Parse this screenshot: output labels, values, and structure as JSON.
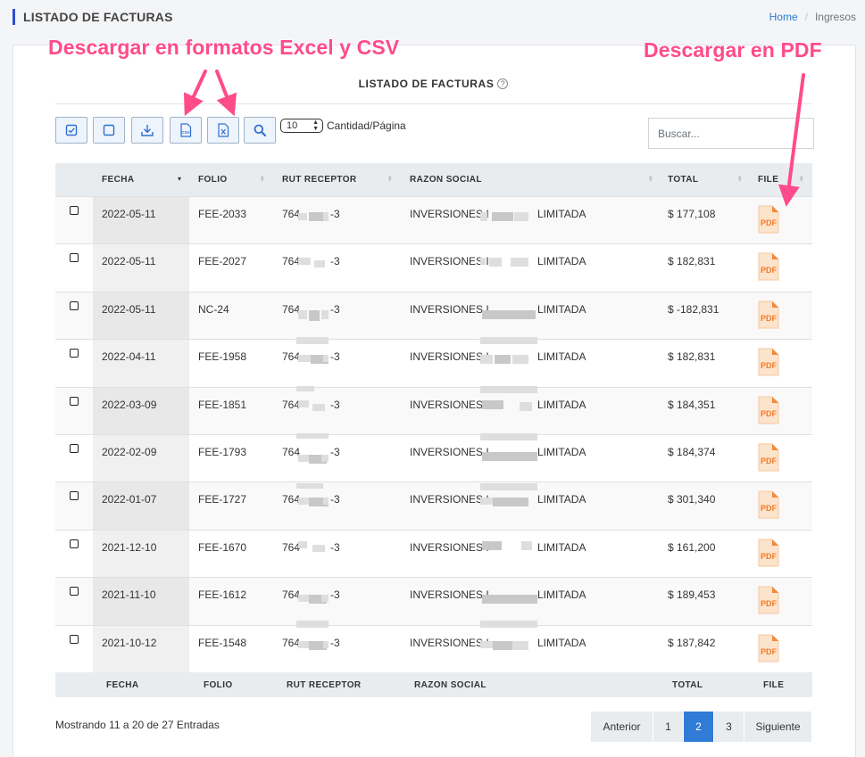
{
  "header": {
    "title": "LISTADO DE FACTURAS",
    "breadcrumb_home": "Home",
    "breadcrumb_separator": "/",
    "breadcrumb_current": "Ingresos"
  },
  "annotations": {
    "excel_csv": "Descargar en formatos Excel y CSV",
    "pdf": "Descargar en PDF",
    "color": "#ff4b8a"
  },
  "card": {
    "title": "LISTADO DE FACTURAS",
    "help_icon": "?"
  },
  "toolbar": {
    "buttons": [
      {
        "name": "select-all-button",
        "icon": "checked-box-icon"
      },
      {
        "name": "deselect-all-button",
        "icon": "empty-box-icon"
      },
      {
        "name": "download-button",
        "icon": "download-icon"
      },
      {
        "name": "csv-button",
        "icon": "csv-file-icon"
      },
      {
        "name": "excel-button",
        "icon": "excel-file-icon"
      },
      {
        "name": "search-button",
        "icon": "magnifier-icon"
      }
    ],
    "page_size": "10",
    "page_size_label": "Cantidad/Página",
    "search_placeholder": "Buscar..."
  },
  "table": {
    "columns": [
      "FECHA",
      "FOLIO",
      "RUT RECEPTOR",
      "RAZON SOCIAL",
      "TOTAL",
      "FILE"
    ],
    "rows": [
      {
        "fecha": "2022-05-11",
        "folio": "FEE-2033",
        "rut_prefix": "764",
        "rut_suffix": "-3",
        "razon_prefix": "INVERSIONES I",
        "razon_suffix": "LIMITADA",
        "total": "$ 177,108",
        "file": "PDF"
      },
      {
        "fecha": "2022-05-11",
        "folio": "FEE-2027",
        "rut_prefix": "764",
        "rut_suffix": "-3",
        "razon_prefix": "INVERSIONES I",
        "razon_suffix": "LIMITADA",
        "total": "$ 182,831",
        "file": "PDF"
      },
      {
        "fecha": "2022-05-11",
        "folio": "NC-24",
        "rut_prefix": "764",
        "rut_suffix": "-3",
        "razon_prefix": "INVERSIONES I",
        "razon_suffix": "LIMITADA",
        "total": "$ -182,831",
        "file": "PDF"
      },
      {
        "fecha": "2022-04-11",
        "folio": "FEE-1958",
        "rut_prefix": "764",
        "rut_suffix": "-3",
        "razon_prefix": "INVERSIONES I",
        "razon_suffix": "LIMITADA",
        "total": "$ 182,831",
        "file": "PDF"
      },
      {
        "fecha": "2022-03-09",
        "folio": "FEE-1851",
        "rut_prefix": "764",
        "rut_suffix": "-3",
        "razon_prefix": "INVERSIONES I",
        "razon_suffix": "LIMITADA",
        "total": "$ 184,351",
        "file": "PDF"
      },
      {
        "fecha": "2022-02-09",
        "folio": "FEE-1793",
        "rut_prefix": "764",
        "rut_suffix": "-3",
        "razon_prefix": "INVERSIONES I",
        "razon_suffix": "LIMITADA",
        "total": "$ 184,374",
        "file": "PDF"
      },
      {
        "fecha": "2022-01-07",
        "folio": "FEE-1727",
        "rut_prefix": "764",
        "rut_suffix": "-3",
        "razon_prefix": "INVERSIONES I",
        "razon_suffix": "LIMITADA",
        "total": "$ 301,340",
        "file": "PDF"
      },
      {
        "fecha": "2021-12-10",
        "folio": "FEE-1670",
        "rut_prefix": "764",
        "rut_suffix": "-3",
        "razon_prefix": "INVERSIONES I",
        "razon_suffix": "LIMITADA",
        "total": "$ 161,200",
        "file": "PDF"
      },
      {
        "fecha": "2021-11-10",
        "folio": "FEE-1612",
        "rut_prefix": "764",
        "rut_suffix": "-3",
        "razon_prefix": "INVERSIONES I",
        "razon_suffix": "LIMITADA",
        "total": "$ 189,453",
        "file": "PDF"
      },
      {
        "fecha": "2021-10-12",
        "folio": "FEE-1548",
        "rut_prefix": "764",
        "rut_suffix": "-3",
        "razon_prefix": "INVERSIONES I",
        "razon_suffix": "LIMITADA",
        "total": "$ 187,842",
        "file": "PDF"
      }
    ]
  },
  "footer": {
    "info": "Mostrando 11 a 20 de 27 Entradas",
    "pagination": {
      "prev": "Anterior",
      "pages": [
        "1",
        "2",
        "3"
      ],
      "active": "2",
      "next": "Siguiente"
    }
  },
  "colors": {
    "accent": "#2f7bd6",
    "title_bar": "#2f4ecf",
    "pdf_icon": "#f08a3c"
  }
}
